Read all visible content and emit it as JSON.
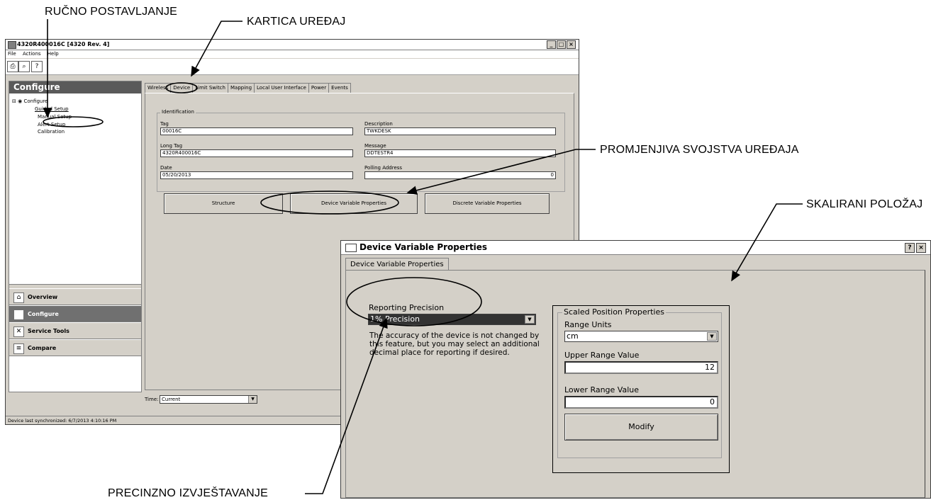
{
  "callouts": {
    "manual_setup": "RUČNO POSTAVLJANJE",
    "device_tab": "KARTICA UREĐAJ",
    "device_variable_props": "PROMJENJIVA SVOJSTVA UREĐAJA",
    "scaled_position": "SKALIRANI POLOŽAJ",
    "reporting_precision": "PRECINZNO IZVJEŠTAVANJE"
  },
  "main_window": {
    "title": "4320R400016C [4320 Rev. 4]",
    "menu": [
      "File",
      "Actions",
      "Help"
    ],
    "panel_title": "Configure",
    "tree": {
      "root": "Configure",
      "items": [
        "Guided Setup",
        "Manual Setup",
        "Alert Setup",
        "Calibration"
      ]
    },
    "nav": [
      "Overview",
      "Configure",
      "Service Tools",
      "Compare"
    ],
    "tabs": [
      "Wireless",
      "Device",
      "Limit Switch",
      "Mapping",
      "Local User Interface",
      "Power",
      "Events"
    ],
    "identification": {
      "group_label": "Identification",
      "tag_label": "Tag",
      "tag_value": "00016C",
      "description_label": "Description",
      "description_value": "TWKDESK",
      "long_tag_label": "Long Tag",
      "long_tag_value": "4320R400016C",
      "message_label": "Message",
      "message_value": "DDTESTR4",
      "date_label": "Date",
      "date_value": "05/20/2013",
      "polling_label": "Polling Address",
      "polling_value": "0"
    },
    "buttons": {
      "structure": "Structure",
      "device_variable_properties": "Device Variable Properties",
      "discrete_variable_properties": "Discrete Variable Properties"
    },
    "time_label": "Time:",
    "time_value": "Current",
    "status": "Device last synchronized: 6/7/2013 4:10:16 PM"
  },
  "dialog": {
    "title": "Device Variable Properties",
    "tab": "Device Variable Properties",
    "reporting_precision_label": "Reporting Precision",
    "reporting_precision_value": "1% Precision",
    "note": [
      "The accuracy of the device is not changed by",
      "this feature, but you may select an additional",
      "decimal place for reporting if desired."
    ],
    "scaled_group_label": "Scaled Position Properties",
    "range_units_label": "Range Units",
    "range_units_value": "cm",
    "upper_label": "Upper Range Value",
    "upper_value": "12",
    "lower_label": "Lower Range Value",
    "lower_value": "0",
    "modify": "Modify"
  }
}
